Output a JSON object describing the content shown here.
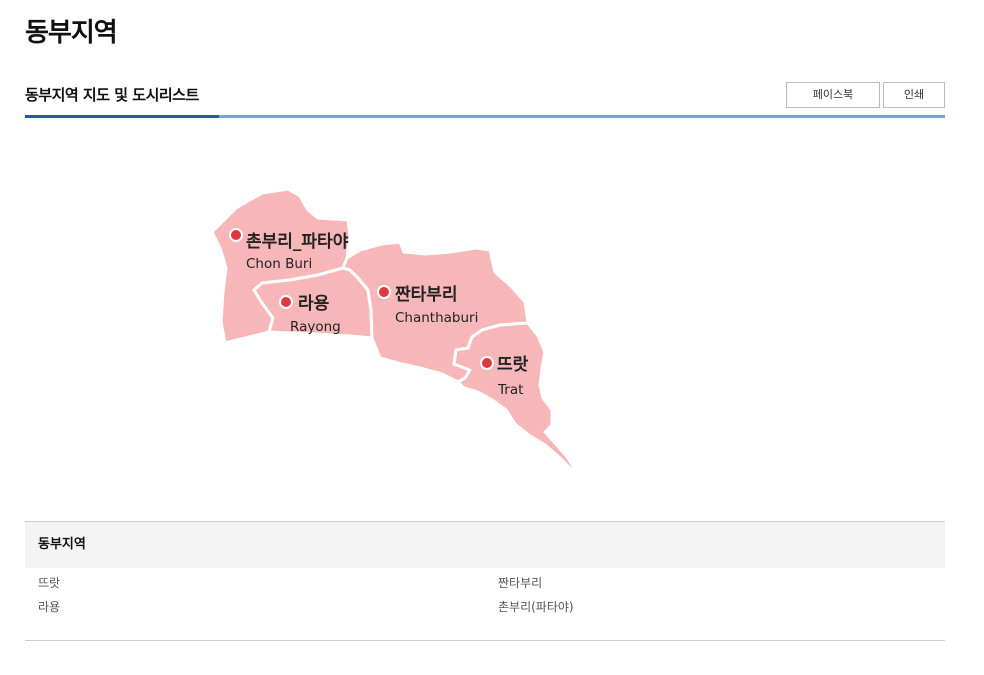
{
  "page": {
    "title": "동부지역"
  },
  "section": {
    "title": "동부지역 지도 및 도시리스트",
    "facebook_label": "페이스북",
    "print_label": "인쇄"
  },
  "map": {
    "regions": [
      {
        "ko": "촌부리_파타야",
        "en": "Chon Buri"
      },
      {
        "ko": "라용",
        "en": "Rayong"
      },
      {
        "ko": "짠타부리",
        "en": "Chanthaburi"
      },
      {
        "ko": "뜨랏",
        "en": "Trat"
      }
    ],
    "colors": {
      "region_fill": "#f7b7b9",
      "marker": "#e0383e",
      "accent_dark": "#1f5aa4",
      "accent_light": "#6aa9df"
    }
  },
  "city_list": {
    "heading": "동부지역",
    "items": [
      "뜨랏",
      "짠타부리",
      "라용",
      "촌부리(파타야)"
    ]
  }
}
